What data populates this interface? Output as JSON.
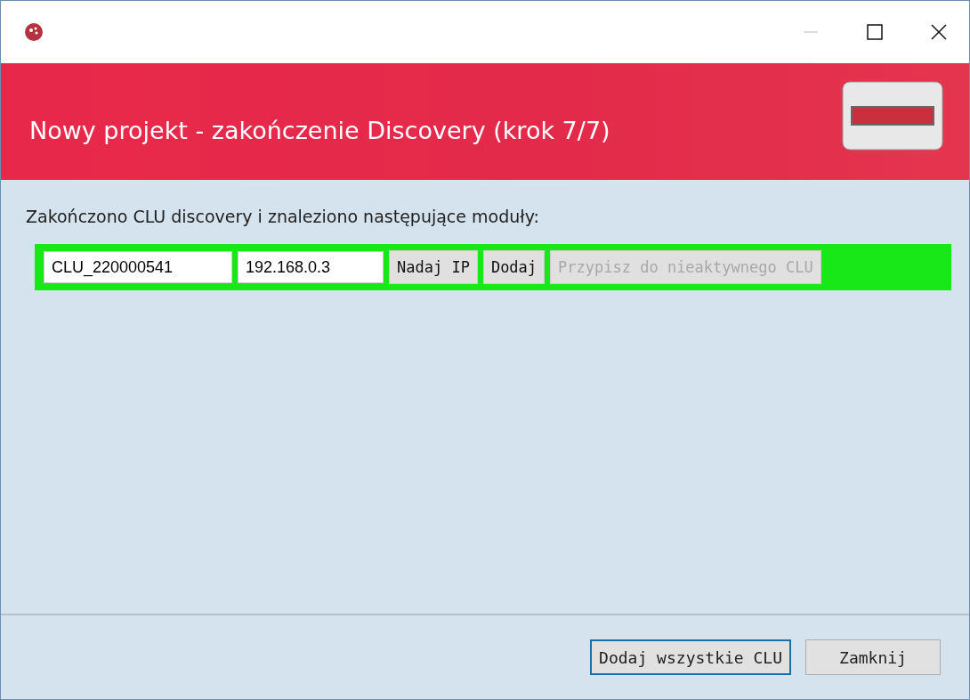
{
  "header": {
    "title": "Nowy projekt - zakończenie Discovery (krok 7/7)"
  },
  "message": "Zakończono CLU discovery i znaleziono następujące moduły:",
  "modules": [
    {
      "name": "CLU_220000541",
      "ip": "192.168.0.3",
      "actions": [
        {
          "label": "Nadaj IP",
          "disabled": false
        },
        {
          "label": "Dodaj",
          "disabled": false
        },
        {
          "label": "Przypisz do nieaktywnego CLU",
          "disabled": true
        }
      ]
    }
  ],
  "buttons": [
    {
      "label": "Dodaj wszystkie CLU",
      "focused": true
    },
    {
      "label": "Zamknij",
      "focused": false
    }
  ]
}
